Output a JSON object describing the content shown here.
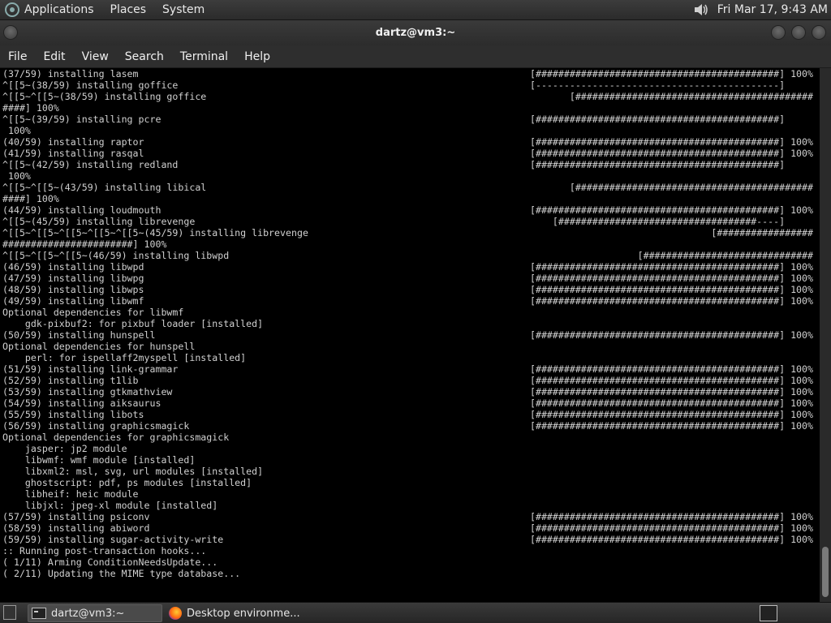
{
  "top_panel": {
    "menus": [
      "Applications",
      "Places",
      "System"
    ],
    "clock": "Fri Mar 17,  9:43 AM",
    "icons": {
      "logo": "distro-logo-icon",
      "volume": "speaker-icon"
    }
  },
  "window": {
    "title": "dartz@vm3:~"
  },
  "menubar": [
    "File",
    "Edit",
    "View",
    "Search",
    "Terminal",
    "Help"
  ],
  "terminal_lines": [
    {
      "l": "(37/59) installing lasem",
      "r": "[###########################################] 100%"
    },
    {
      "l": "^[[5~(38/59) installing goffice",
      "r": "[-------------------------------------------]     "
    },
    {
      "l": "^[[5~^[[5~(38/59) installing goffice",
      "r": "[##########################################"
    },
    {
      "l": "####] 100%",
      "r": ""
    },
    {
      "l": "^[[5~(39/59) installing pcre",
      "r": "[###########################################]     "
    },
    {
      "l": " 100%",
      "r": ""
    },
    {
      "l": "(40/59) installing raptor",
      "r": "[###########################################] 100%"
    },
    {
      "l": "(41/59) installing rasqal",
      "r": "[###########################################] 100%"
    },
    {
      "l": "^[[5~(42/59) installing redland",
      "r": "[###########################################]     "
    },
    {
      "l": " 100%",
      "r": ""
    },
    {
      "l": "^[[5~^[[5~(43/59) installing libical",
      "r": "[##########################################"
    },
    {
      "l": "####] 100%",
      "r": ""
    },
    {
      "l": "(44/59) installing loudmouth",
      "r": "[###########################################] 100%"
    },
    {
      "l": "^[[5~(45/59) installing librevenge",
      "r": "[###################################----]     "
    },
    {
      "l": "^[[5~^[[5~^[[5~^[[5~^[[5~(45/59) installing librevenge",
      "r": "[#################"
    },
    {
      "l": "#######################] 100%",
      "r": ""
    },
    {
      "l": "^[[5~^[[5~^[[5~(46/59) installing libwpd",
      "r": "[##############################"
    },
    {
      "l": "(46/59) installing libwpd",
      "r": "[###########################################] 100%"
    },
    {
      "l": "(47/59) installing libwpg",
      "r": "[###########################################] 100%"
    },
    {
      "l": "(48/59) installing libwps",
      "r": "[###########################################] 100%"
    },
    {
      "l": "(49/59) installing libwmf",
      "r": "[###########################################] 100%"
    },
    {
      "l": "Optional dependencies for libwmf",
      "r": ""
    },
    {
      "l": "    gdk-pixbuf2: for pixbuf loader [installed]",
      "r": ""
    },
    {
      "l": "(50/59) installing hunspell",
      "r": "[###########################################] 100%"
    },
    {
      "l": "Optional dependencies for hunspell",
      "r": ""
    },
    {
      "l": "    perl: for ispellaff2myspell [installed]",
      "r": ""
    },
    {
      "l": "(51/59) installing link-grammar",
      "r": "[###########################################] 100%"
    },
    {
      "l": "(52/59) installing t1lib",
      "r": "[###########################################] 100%"
    },
    {
      "l": "(53/59) installing gtkmathview",
      "r": "[###########################################] 100%"
    },
    {
      "l": "(54/59) installing aiksaurus",
      "r": "[###########################################] 100%"
    },
    {
      "l": "(55/59) installing libots",
      "r": "[###########################################] 100%"
    },
    {
      "l": "(56/59) installing graphicsmagick",
      "r": "[###########################################] 100%"
    },
    {
      "l": "Optional dependencies for graphicsmagick",
      "r": ""
    },
    {
      "l": "    jasper: jp2 module",
      "r": ""
    },
    {
      "l": "    libwmf: wmf module [installed]",
      "r": ""
    },
    {
      "l": "    libxml2: msl, svg, url modules [installed]",
      "r": ""
    },
    {
      "l": "    ghostscript: pdf, ps modules [installed]",
      "r": ""
    },
    {
      "l": "    libheif: heic module",
      "r": ""
    },
    {
      "l": "    libjxl: jpeg-xl module [installed]",
      "r": ""
    },
    {
      "l": "(57/59) installing psiconv",
      "r": "[###########################################] 100%"
    },
    {
      "l": "(58/59) installing abiword",
      "r": "[###########################################] 100%"
    },
    {
      "l": "(59/59) installing sugar-activity-write",
      "r": "[###########################################] 100%"
    },
    {
      "l": ":: Running post-transaction hooks...",
      "r": ""
    },
    {
      "l": "( 1/11) Arming ConditionNeedsUpdate...",
      "r": ""
    },
    {
      "l": "( 2/11) Updating the MIME type database...",
      "r": ""
    }
  ],
  "taskbar": {
    "tasks": [
      {
        "label": "dartz@vm3:~",
        "icon": "terminal-icon",
        "active": true
      },
      {
        "label": "Desktop environme...",
        "icon": "firefox-icon",
        "active": false
      }
    ]
  }
}
